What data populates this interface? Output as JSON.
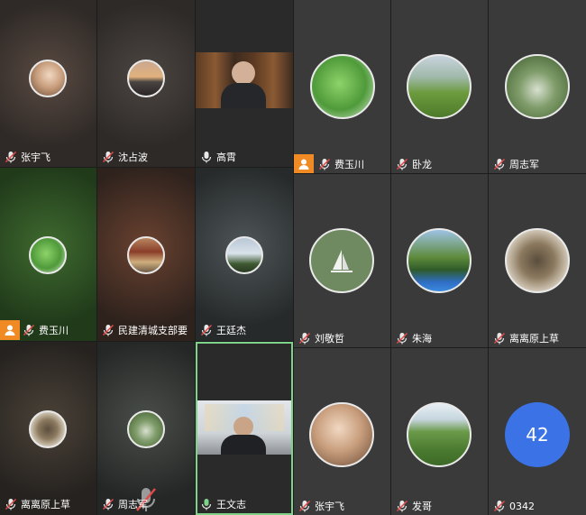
{
  "participants": [
    {
      "name": "张宇飞"
    },
    {
      "name": "沈占波"
    },
    {
      "name": "高霄"
    },
    {
      "name": "费玉川"
    },
    {
      "name": "卧龙"
    },
    {
      "name": "周志军"
    },
    {
      "name": "费玉川"
    },
    {
      "name": "民建清城支部要"
    },
    {
      "name": "王廷杰"
    },
    {
      "name": "刘敬哲"
    },
    {
      "name": "朱海"
    },
    {
      "name": "离离原上草"
    },
    {
      "name": "离离原上草"
    },
    {
      "name": "周志军"
    },
    {
      "name": "王文志"
    },
    {
      "name": "张宇飞"
    },
    {
      "name": "发哥"
    },
    {
      "name": "0342"
    }
  ],
  "overflow_count": "42",
  "colors": {
    "host_badge": "#f08a24",
    "count_circle": "#3b73e6",
    "active_speaker_border": "#7fd28a"
  }
}
